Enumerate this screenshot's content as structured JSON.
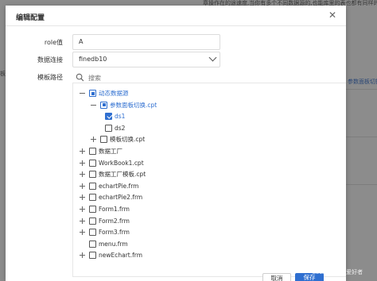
{
  "background": {
    "top_text": "章操作在的途速度,当你有多个不同数据源的,也能库里的表也都有同样的结构一样的,只是数据不一样, 当你是开",
    "left_char": "板",
    "right_link": "参数面板切换"
  },
  "modal": {
    "title": "编辑配置",
    "close_icon": "close-icon"
  },
  "form": {
    "role_label": "role值",
    "role_value": "A",
    "connection_label": "数据连接",
    "connection_value": "finedb10",
    "template_path_label": "模板路径",
    "search_placeholder": "搜索"
  },
  "tree": [
    {
      "label": "动态数据源",
      "expander": "minus",
      "checkbox": "partial",
      "level": 0,
      "color": "blue"
    },
    {
      "label": "参数面板切换.cpt",
      "expander": "minus",
      "checkbox": "partial",
      "level": 1,
      "color": "blue"
    },
    {
      "label": "ds1",
      "expander": "none",
      "checkbox": "checked",
      "level": 2,
      "color": "blue"
    },
    {
      "label": "ds2",
      "expander": "none",
      "checkbox": "unchecked",
      "level": 2,
      "color": "default"
    },
    {
      "label": "模板切换.cpt",
      "expander": "plus",
      "checkbox": "unchecked",
      "level": 1,
      "color": "default"
    },
    {
      "label": "数据工厂",
      "expander": "plus",
      "checkbox": "unchecked",
      "level": 0,
      "color": "default"
    },
    {
      "label": "WorkBook1.cpt",
      "expander": "plus",
      "checkbox": "unchecked",
      "level": 0,
      "color": "default"
    },
    {
      "label": "数据工厂模板.cpt",
      "expander": "plus",
      "checkbox": "unchecked",
      "level": 0,
      "color": "default"
    },
    {
      "label": "echartPie.frm",
      "expander": "plus",
      "checkbox": "unchecked",
      "level": 0,
      "color": "default"
    },
    {
      "label": "echartPie2.frm",
      "expander": "plus",
      "checkbox": "unchecked",
      "level": 0,
      "color": "default"
    },
    {
      "label": "Form1.frm",
      "expander": "plus",
      "checkbox": "unchecked",
      "level": 0,
      "color": "default"
    },
    {
      "label": "Form2.frm",
      "expander": "plus",
      "checkbox": "unchecked",
      "level": 0,
      "color": "default"
    },
    {
      "label": "Form3.frm",
      "expander": "plus",
      "checkbox": "unchecked",
      "level": 0,
      "color": "default"
    },
    {
      "label": "menu.frm",
      "expander": "none",
      "checkbox": "unchecked",
      "level": 0,
      "color": "default"
    },
    {
      "label": "newEchart.frm",
      "expander": "plus",
      "checkbox": "unchecked",
      "level": 0,
      "color": "default"
    }
  ],
  "footer": {
    "cancel_label": "取消",
    "save_label": "保存"
  },
  "watermark": "CSDN @帆软爱好者",
  "colors": {
    "accent": "#2f6fd0",
    "overlay": "rgba(0,0,0,0.45)"
  }
}
